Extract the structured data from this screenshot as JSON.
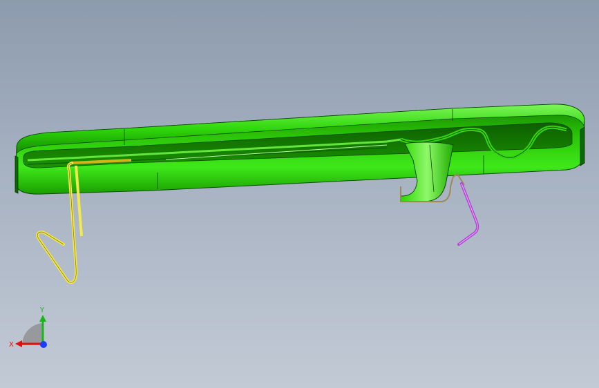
{
  "viewport": {
    "background_top": "#8d9bae",
    "background_bottom": "#c2cad5"
  },
  "model": {
    "parts": [
      {
        "name": "rail-housing",
        "color": "#1fd400"
      },
      {
        "name": "left-clip-wire",
        "color": "#f4e94a"
      },
      {
        "name": "bracket-wire",
        "color": "#9c8a56"
      },
      {
        "name": "right-hook-wire",
        "color": "#b23fd8"
      }
    ]
  },
  "triad": {
    "x_label": "X",
    "y_label": "Y",
    "x_color": "#e01010",
    "y_color": "#18b818",
    "z_color": "#1a3cff"
  }
}
